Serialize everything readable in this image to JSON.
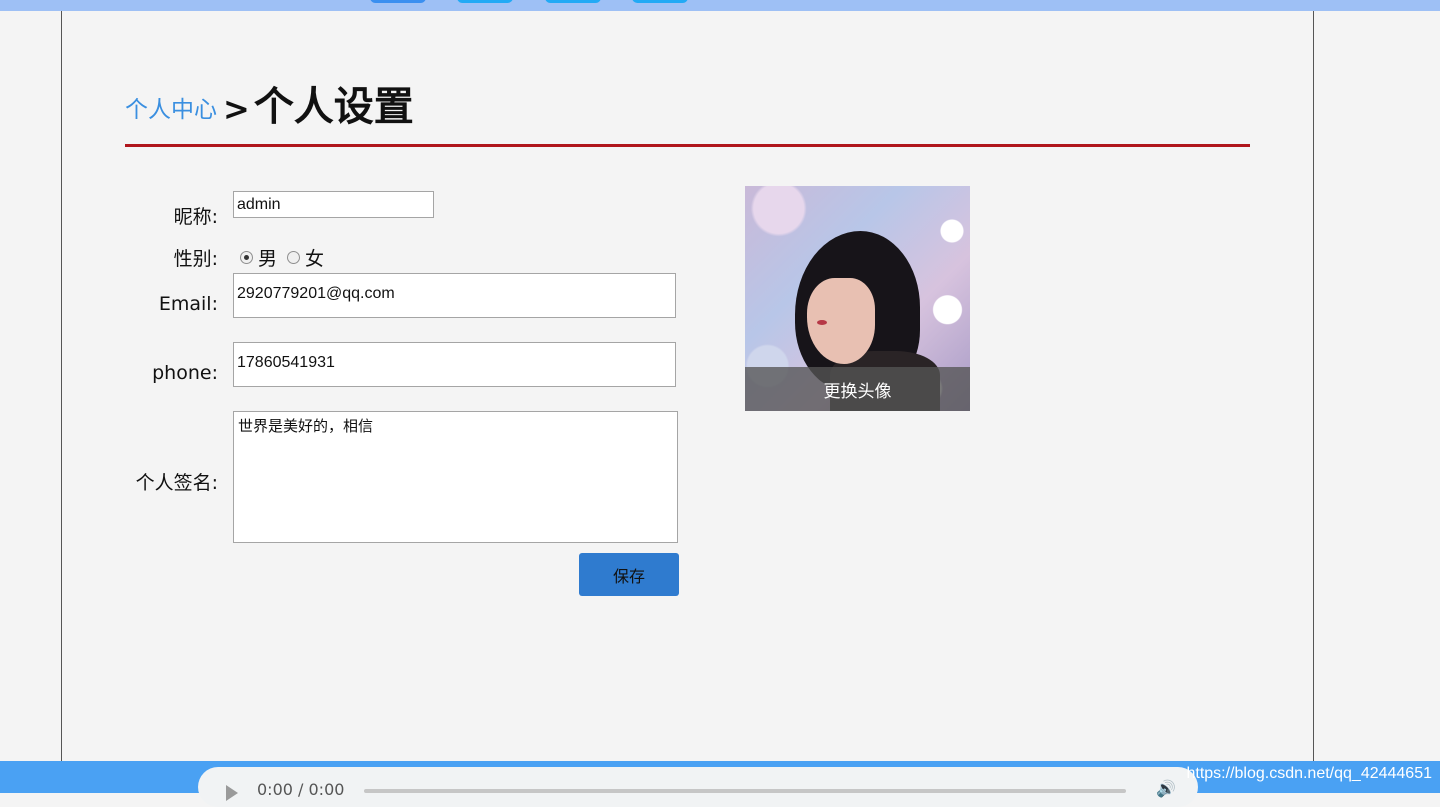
{
  "header": {
    "breadcrumb_link": "个人中心",
    "breadcrumb_separator": ">",
    "page_title": "个人设置"
  },
  "form": {
    "nickname_label": "昵称:",
    "nickname_value": "admin",
    "gender_label": "性别:",
    "gender_options": [
      "男",
      "女"
    ],
    "gender_selected": "男",
    "email_label": "Email:",
    "email_value": "2920779201@qq.com",
    "phone_label": "phone:",
    "phone_value": "17860541931",
    "signature_label": "个人签名:",
    "signature_value": "世界是美好的，相信",
    "save_label": "保存"
  },
  "avatar": {
    "change_label": "更换头像"
  },
  "audio_player": {
    "time": "0:00 / 0:00"
  },
  "watermark": "https://blog.csdn.net/qq_42444651",
  "colors": {
    "top_bar": "#9ec0f5",
    "bottom_bar": "#4aa1f3",
    "divider": "#b0151c",
    "link": "#3a8fe0",
    "save_button": "#2f7bcf"
  }
}
